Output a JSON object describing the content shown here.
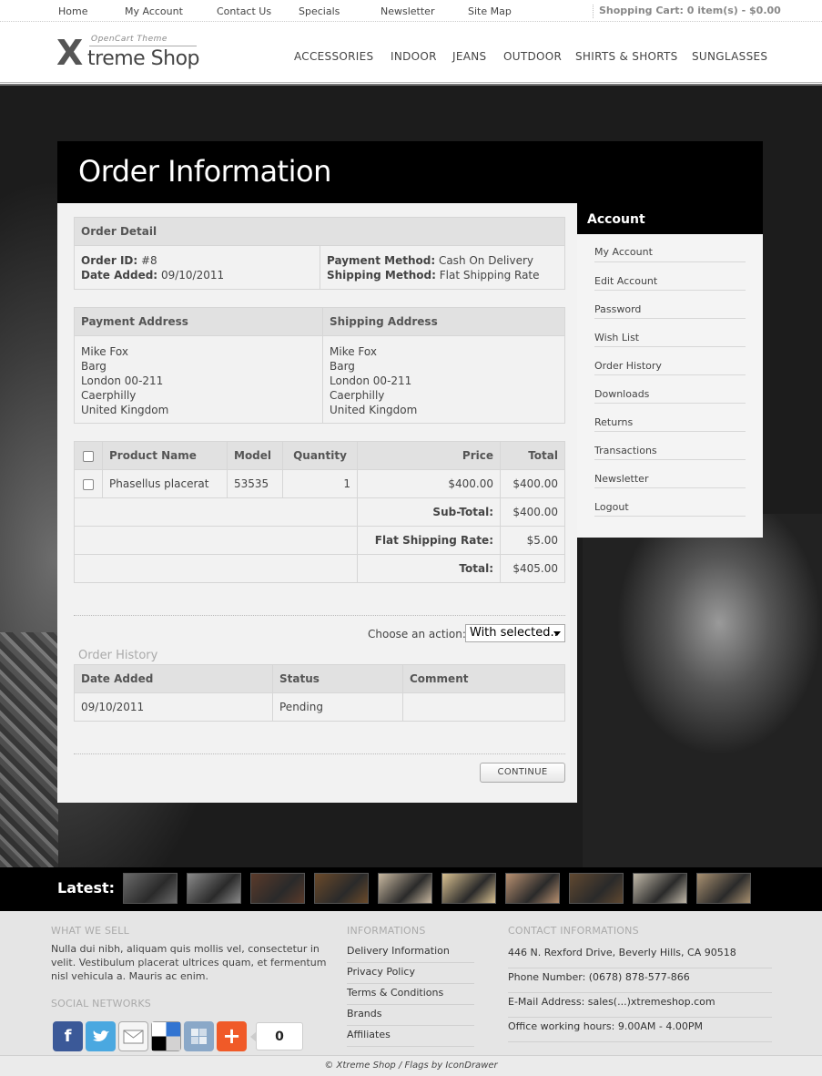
{
  "topnav": [
    "Home",
    "My Account",
    "Contact Us",
    "Specials",
    "Newsletter",
    "Site Map"
  ],
  "cart": "Shopping Cart: 0 item(s) - $0.00",
  "logo": {
    "small": "OpenCart Theme",
    "x": "X",
    "main": "treme Shop"
  },
  "mainnav": [
    "ACCESSORIES",
    "INDOOR",
    "JEANS",
    "OUTDOOR",
    "SHIRTS & SHORTS",
    "SUNGLASSES"
  ],
  "page_title": "Order Information",
  "order_detail": {
    "heading": "Order Detail",
    "order_id_label": "Order ID:",
    "order_id": "#8",
    "date_added_label": "Date Added:",
    "date_added": "09/10/2011",
    "payment_method_label": "Payment Method:",
    "payment_method": "Cash On Delivery",
    "shipping_method_label": "Shipping Method:",
    "shipping_method": "Flat Shipping Rate"
  },
  "payment_address": {
    "heading": "Payment Address",
    "lines": [
      "Mike Fox",
      "Barg",
      "London 00-211",
      "Caerphilly",
      "United Kingdom"
    ]
  },
  "shipping_address": {
    "heading": "Shipping Address",
    "lines": [
      "Mike Fox",
      "Barg",
      "London 00-211",
      "Caerphilly",
      "United Kingdom"
    ]
  },
  "products": {
    "headers": [
      "Product Name",
      "Model",
      "Quantity",
      "Price",
      "Total"
    ],
    "rows": [
      {
        "name": "Phasellus placerat",
        "model": "53535",
        "quantity": "1",
        "price": "$400.00",
        "total": "$400.00"
      }
    ],
    "totals": [
      {
        "label": "Sub-Total:",
        "value": "$400.00"
      },
      {
        "label": "Flat Shipping Rate:",
        "value": "$5.00"
      },
      {
        "label": "Total:",
        "value": "$405.00"
      }
    ]
  },
  "action": {
    "label": "Choose an action:",
    "selected": "With selected.."
  },
  "history": {
    "title": "Order History",
    "headers": [
      "Date Added",
      "Status",
      "Comment"
    ],
    "rows": [
      {
        "date": "09/10/2011",
        "status": "Pending",
        "comment": ""
      }
    ]
  },
  "continue_label": "CONTINUE",
  "sidebar": {
    "heading": "Account",
    "items": [
      "My Account",
      "Edit Account",
      "Password",
      "Wish List",
      "Order History",
      "Downloads",
      "Returns",
      "Transactions",
      "Newsletter",
      "Logout"
    ]
  },
  "latest_label": "Latest:",
  "thumb_colors": [
    "#6a6a6a",
    "#8a8a8a",
    "#5a3a2a",
    "#6b4a2a",
    "#c8b8a0",
    "#d8c090",
    "#b89070",
    "#604830",
    "#c0b8a8",
    "#a89070",
    "#b0a090"
  ],
  "footer": {
    "what_we_sell": {
      "heading": "WHAT WE SELL",
      "text": "Nulla dui nibh, aliquam quis mollis vel, consectetur in velit. Vestibulum placerat ultrices quam, et fermentum nisl vehicula a. Mauris ac enim."
    },
    "social": {
      "heading": "SOCIAL NETWORKS",
      "count": "0"
    },
    "informations": {
      "heading": "INFORMATIONS",
      "items": [
        "Delivery Information",
        "Privacy Policy",
        "Terms & Conditions",
        "Brands",
        "Affiliates"
      ]
    },
    "contact": {
      "heading": "CONTACT INFORMATIONS",
      "items": [
        "446 N. Rexford Drive, Beverly Hills, CA 90518",
        "Phone Number: (0678) 878-577-866",
        "E-Mail Address: sales(...)xtremeshop.com",
        "Office working hours: 9.00AM - 4.00PM"
      ]
    },
    "copyright": "© Xtreme Shop / Flags by IconDrawer"
  }
}
